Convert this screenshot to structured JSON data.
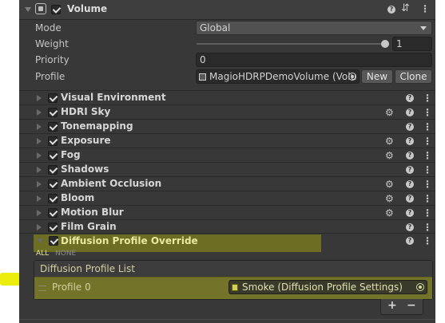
{
  "header": {
    "title": "Volume",
    "help_icon": "help-icon",
    "preset_icon": "preset-icon",
    "more_icon": "more-icon"
  },
  "props": {
    "mode_label": "Mode",
    "mode_value": "Global",
    "weight_label": "Weight",
    "weight_value": "1",
    "weight_fraction": 1.0,
    "priority_label": "Priority",
    "priority_value": "0",
    "profile_label": "Profile",
    "profile_value": "MagioHDRPDemoVolume (Volu",
    "new_label": "New",
    "clone_label": "Clone"
  },
  "overrides": [
    {
      "label": "Visual Environment",
      "gear": false
    },
    {
      "label": "HDRI Sky",
      "gear": true
    },
    {
      "label": "Tonemapping",
      "gear": false
    },
    {
      "label": "Exposure",
      "gear": true
    },
    {
      "label": "Fog",
      "gear": true
    },
    {
      "label": "Shadows",
      "gear": false
    },
    {
      "label": "Ambient Occlusion",
      "gear": true
    },
    {
      "label": "Bloom",
      "gear": true
    },
    {
      "label": "Motion Blur",
      "gear": true
    },
    {
      "label": "Film Grain",
      "gear": false
    }
  ],
  "diffusion": {
    "title": "Diffusion Profile Override",
    "all_label": "ALL",
    "none_label": "NONE",
    "list_title": "Diffusion Profile List",
    "item_label": "Profile 0",
    "item_value": "Smoke (Diffusion Profile Settings)",
    "add_label": "+",
    "remove_label": "−"
  },
  "colors": {
    "highlight": "#dcdc00",
    "panel": "#383838",
    "accent": "#e4e48a"
  }
}
